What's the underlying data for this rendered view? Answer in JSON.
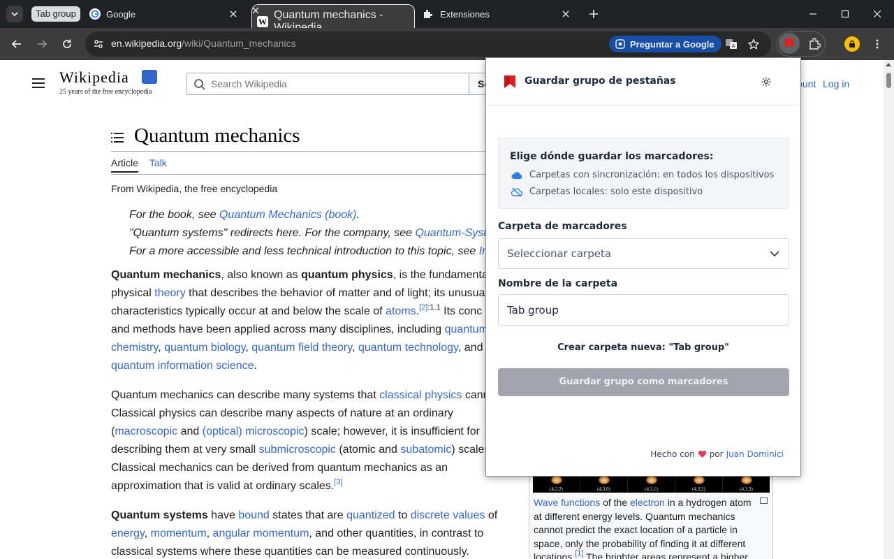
{
  "browser": {
    "tab_group_label": "Tab group",
    "tabs": [
      {
        "title": "Google",
        "icon": "google-favicon"
      },
      {
        "title": "Quantum mechanics - Wikipedia",
        "icon": "wikipedia-favicon",
        "active": true
      },
      {
        "title": "Extensiones",
        "icon": "puzzle-icon"
      }
    ],
    "url_host": "en.wikipedia.org",
    "url_path": "/wiki/Quantum_mechanics",
    "ask_google_label": "Preguntar a Google"
  },
  "wiki": {
    "logo_word": "Wikipedia",
    "logo_tagline": "25 years of the free encyclopedia",
    "search_placeholder": "Search Wikipedia",
    "search_button": "Se",
    "account_link": "ount",
    "login_link": "Log in",
    "title": "Quantum mechanics",
    "tab_article": "Article",
    "tab_talk": "Talk",
    "from_line": "From Wikipedia, the free encyclopedia",
    "hatnotes": [
      {
        "pre": "For the book, see ",
        "link": "Quantum Mechanics (book)",
        "post": "."
      },
      {
        "pre": "\"Quantum systems\" redirects here. For the company, see ",
        "link": "Quantum-Syst",
        "post": ""
      },
      {
        "pre": "For a more accessible and less technical introduction to this topic, see ",
        "link": "In",
        "post": ""
      }
    ],
    "p1": {
      "l1_b1": "Quantum mechanics",
      "l1_t1": ", also known as ",
      "l1_b2": "quantum physics",
      "l1_t2": ", is the fundamenta",
      "l2_t1": "physical ",
      "l2_a1": "theory",
      "l2_t2": " that describes the behavior of matter and of light; its unusua",
      "l3_t1": "characteristics typically occur at and below the scale of ",
      "l3_a1": "atoms",
      "l3_t2": ".",
      "l3_sup": "[2]",
      "l3_sup2": ":1.1",
      "l3_t3": " Its conc",
      "l4_t1": "and methods have been applied across many disciplines, including ",
      "l4_a1": "quantum",
      "l5_a1": "chemistry",
      "l5_t1": ", ",
      "l5_a2": "quantum biology",
      "l5_t2": ", ",
      "l5_a3": "quantum field theory",
      "l5_t3": ", ",
      "l5_a4": "quantum technology",
      "l5_t4": ", and",
      "l6_a1": "quantum information science",
      "l6_t1": "."
    },
    "p2": {
      "l1_t1": "Quantum mechanics can describe many systems that ",
      "l1_a1": "classical physics",
      "l1_t2": " cann",
      "l2": "Classical physics can describe many aspects of nature at an ordinary",
      "l3_t1": "(",
      "l3_a1": "macroscopic",
      "l3_t2": " and ",
      "l3_a2": "(optical) microscopic",
      "l3_t3": ") scale; however, it is insufficient for",
      "l4_t1": "describing them at very small ",
      "l4_a1": "submicroscopic",
      "l4_t2": " (atomic and ",
      "l4_a2": "subatomic",
      "l4_t3": ") scales",
      "l5": "Classical mechanics can be derived from quantum mechanics as an",
      "l6_t1": "approximation that is valid at ordinary scales.",
      "l6_sup": "[3]"
    },
    "p3": {
      "l1_b1": "Quantum systems",
      "l1_t1": " have ",
      "l1_a1": "bound",
      "l1_t2": " states that are ",
      "l1_a2": "quantized",
      "l1_t3": " to ",
      "l1_a3": "discrete values",
      "l1_t4": " of",
      "l2_a1": "energy",
      "l2_t1": ", ",
      "l2_a2": "momentum",
      "l2_t2": ", ",
      "l2_a3": "angular momentum",
      "l2_t3": ", and other quantities, in contrast to",
      "l3": "classical systems where these quantities can be measured continuously."
    },
    "figure": {
      "cell_labels": [
        "(4,2,2)",
        "(4,3,0)",
        "(4,3,1)",
        "(4,3,2)",
        "(4,3,3)"
      ],
      "cap_a1": "Wave functions",
      "cap_t1": " of the ",
      "cap_a2": "electron",
      "cap_t2": " in a hydrogen atom",
      "cap_l2": "at different energy levels. Quantum mechanics",
      "cap_l3": "cannot predict the exact location of a particle in",
      "cap_l4": "space, only the probability of finding it at different",
      "cap_l5_t1": "locations.",
      "cap_l5_sup": "[1]",
      "cap_l5_t2": " The brighter areas represent a higher"
    }
  },
  "popup": {
    "title": "Guardar grupo de pestañas",
    "info_title": "Elige dónde guardar los marcadores:",
    "info_sync": "Carpetas con sincronización: en todos los dispositivos",
    "info_local": "Carpetas locales: solo este dispositivo",
    "folder_label": "Carpeta de marcadores",
    "folder_select_value": "Seleccionar carpeta",
    "name_label": "Nombre de la carpeta",
    "name_value": "Tab group",
    "create_link": "Crear carpeta nueva: \"Tab group\"",
    "save_button": "Guardar grupo como marcadores",
    "footer_made": "Hecho con",
    "footer_by": "por",
    "footer_author": "Juan Dominici"
  },
  "colors": {
    "accent": "#3366cc",
    "popup_brand_red": "#e0201f",
    "disabled_button": "#a1a3ad"
  }
}
